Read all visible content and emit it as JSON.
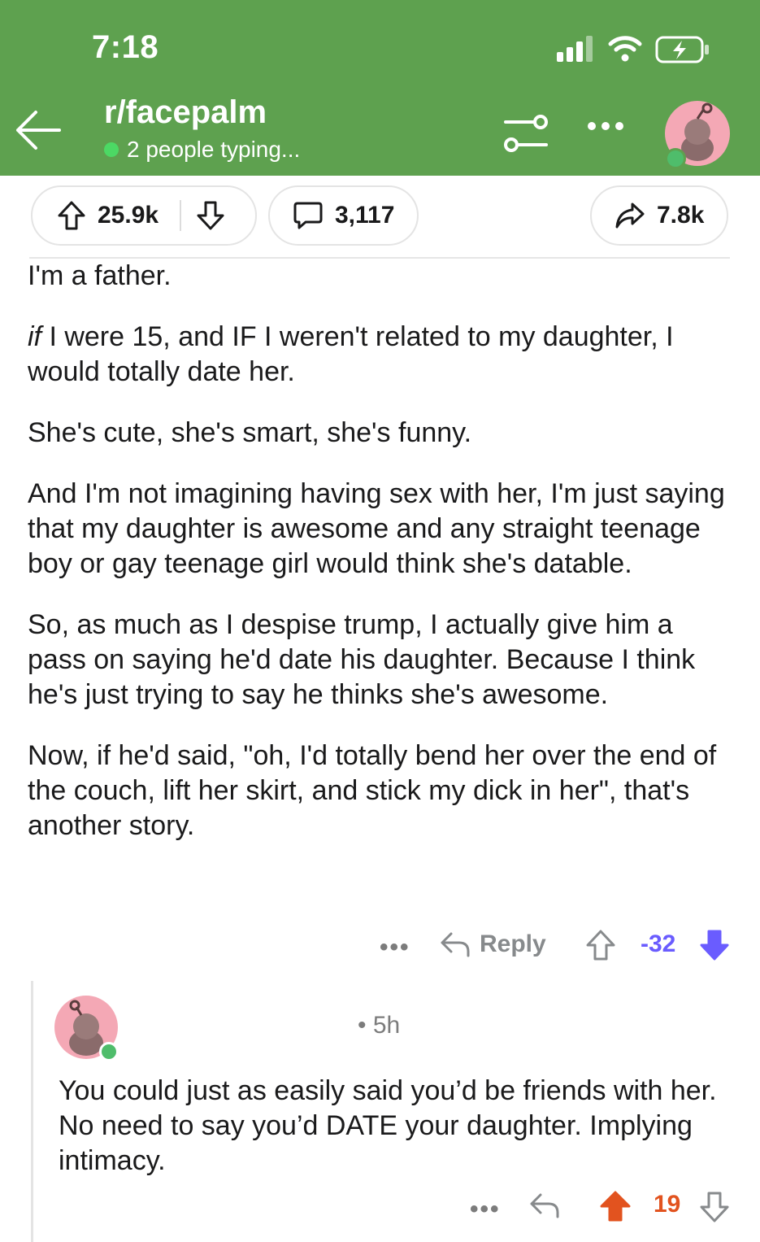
{
  "status_bar": {
    "time": "7:18"
  },
  "header": {
    "subreddit": "r/facepalm",
    "typing_status": "2 people typing..."
  },
  "post_actions": {
    "upvotes": "25.9k",
    "comments": "3,117",
    "shares": "7.8k"
  },
  "comment": {
    "paragraphs": [
      "I'm a father.",
      "I were 15, and IF I weren't related to my daughter, I would totally date her.",
      "She's cute, she's smart, she's funny.",
      "And I'm not imagining having sex with her, I'm just saying that my daughter is awesome and any straight teenage boy or gay teenage girl would think she's datable.",
      "So, as much as I despise trump,  I actually give him a pass on saying he'd date his daughter.   Because I think he's just trying to say he thinks she's awesome.",
      "Now, if he'd said, \"oh, I'd totally bend her over the end of the couch, lift her skirt, and stick my dick in her\", that's another story."
    ],
    "italic_lead": "if",
    "more_label": "•••",
    "reply_label": "Reply",
    "score": "-32"
  },
  "reply": {
    "time_ago": "• 5h",
    "text": "You could just as easily said you’d be friends with her. No need to say you’d DATE your daughter. Implying intimacy.",
    "more_label": "•••",
    "score": "19"
  },
  "colors": {
    "header_bg": "#5ea14f",
    "downvote_active": "#6a5cff",
    "upvote_active": "#e2531f",
    "online": "#4fbd6b"
  },
  "icons": [
    "back-arrow-icon",
    "filter-icon",
    "more-icon",
    "upvote-icon",
    "downvote-icon",
    "comment-icon",
    "share-icon",
    "reply-icon",
    "signal-icon",
    "wifi-icon",
    "battery-icon"
  ]
}
